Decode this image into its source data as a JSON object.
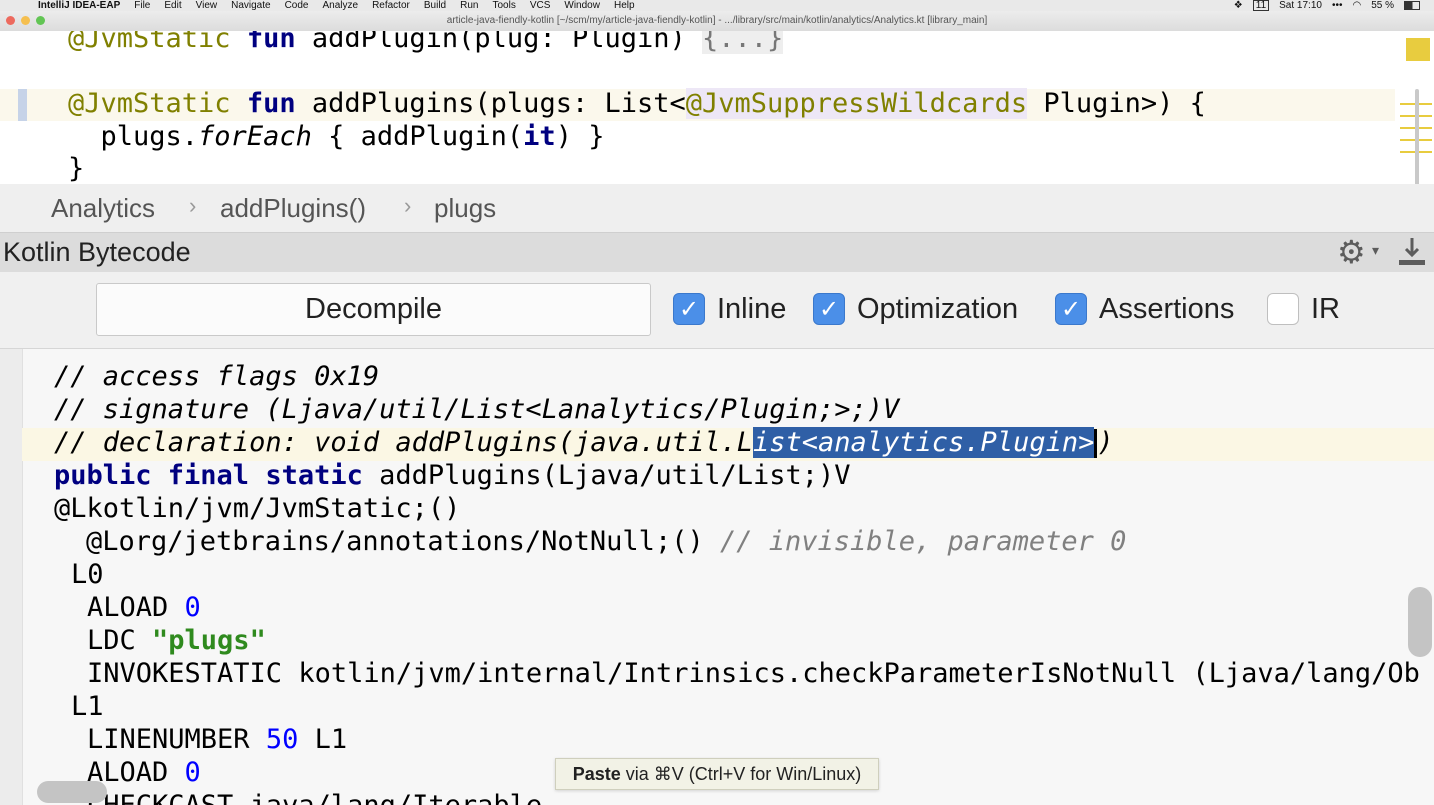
{
  "menubar": {
    "app": "IntelliJ IDEA-EAP",
    "items": [
      "File",
      "Edit",
      "View",
      "Navigate",
      "Code",
      "Analyze",
      "Refactor",
      "Build",
      "Run",
      "Tools",
      "VCS",
      "Window",
      "Help"
    ],
    "clock": "Sat 17:10",
    "battery": "55 %",
    "calendar_day": "11"
  },
  "window": {
    "title": "article-java-fiendly-kotlin [~/scm/my/article-java-fiendly-kotlin] - .../library/src/main/kotlin/analytics/Analytics.kt [library_main]"
  },
  "editor": {
    "line1": {
      "annotation": "@JvmStatic",
      "kw": "fun",
      "rest": " addPlugin(plug: Plugin) ",
      "fold": "{...}"
    },
    "line2": {
      "annotation": "@JvmStatic",
      "kw": "fun",
      "pre": " addPlugins(plugs: List<",
      "annotation2": "@JvmSuppressWildcards",
      "post": " Plugin>) {"
    },
    "line3": {
      "pre": "  plugs.",
      "italic": "forEach",
      "post": " { addPlugin(",
      "bold": "it",
      "tail": ") }"
    },
    "line4": "}"
  },
  "breadcrumb": {
    "items": [
      "Analytics",
      "addPlugins()",
      "plugs"
    ],
    "separator": "›"
  },
  "tool_window": {
    "title": "Kotlin Bytecode",
    "decompile_label": "Decompile",
    "options": [
      {
        "label": "Inline",
        "checked": true
      },
      {
        "label": "Optimization",
        "checked": true
      },
      {
        "label": "Assertions",
        "checked": true
      },
      {
        "label": "IR",
        "checked": false
      }
    ]
  },
  "bytecode": {
    "l1": "// access flags 0x19",
    "l2": "// signature (Ljava/util/List<Lanalytics/Plugin;>;)V",
    "l3_pre": "// declaration: void addPlugins(java.util.L",
    "l3_sel": "ist<analytics.Plugin>",
    "l3_post": ")",
    "l4_kw": "public final static",
    "l4_rest": " addPlugins(Ljava/util/List;)V",
    "l5": "@Lkotlin/jvm/JvmStatic;()",
    "l6_code": "@Lorg/jetbrains/annotations/NotNull;()",
    "l6_comment": " // invisible, parameter 0",
    "l7": "L0",
    "l8_op": "ALOAD ",
    "l8_num": "0",
    "l9_op": "LDC ",
    "l9_str": "\"plugs\"",
    "l10": "INVOKESTATIC kotlin/jvm/internal/Intrinsics.checkParameterIsNotNull (Ljava/lang/Ob",
    "l11": "L1",
    "l12_op": "LINENUMBER ",
    "l12_num": "50",
    "l12_rest": " L1",
    "l13_op": "ALOAD ",
    "l13_num": "0",
    "l14": "CHECKCAST java/lang/Iterable"
  },
  "tooltip": {
    "bold": "Paste",
    "rest": " via ⌘V (Ctrl+V for Win/Linux)"
  },
  "colors": {
    "keyword": "#000080",
    "annotation": "#808000",
    "comment": "#808080",
    "number": "#0000ff",
    "string": "#2f8a1e",
    "selection": "#2f5fa6",
    "checkbox": "#4b8fe8",
    "warning_marker": "#e8cc3f"
  }
}
